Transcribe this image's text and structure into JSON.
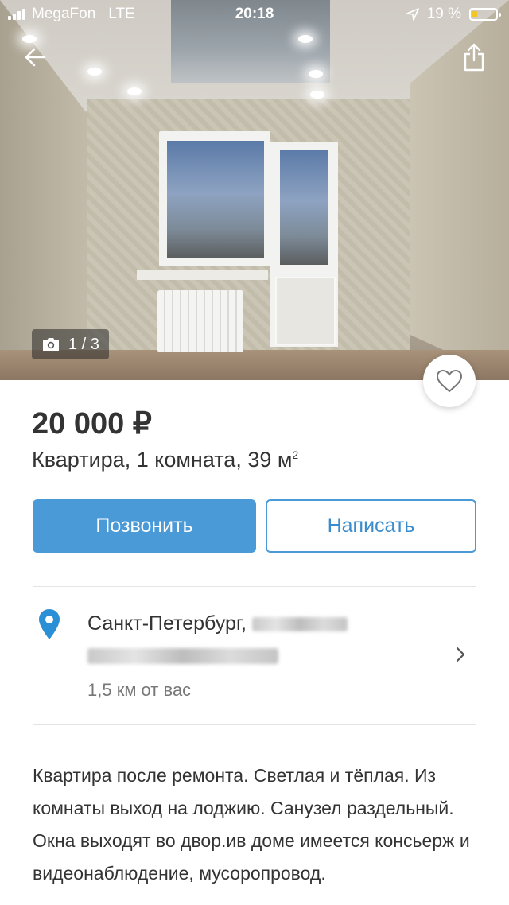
{
  "status_bar": {
    "carrier": "MegaFon",
    "network": "LTE",
    "time": "20:18",
    "battery": "19 %",
    "battery_level": 0.19
  },
  "header": {
    "back_icon": "arrow-left-icon",
    "share_icon": "share-icon"
  },
  "gallery": {
    "camera_icon": "camera-icon",
    "counter": "1 / 3",
    "favorite_icon": "heart-icon"
  },
  "listing": {
    "price": "20 000 ₽",
    "title": "Квартира, 1 комната, 39 м",
    "title_sup": "2"
  },
  "actions": {
    "call_label": "Позвонить",
    "message_label": "Написать"
  },
  "location": {
    "pin_icon": "location-pin-icon",
    "city": "Санкт-Петербург,",
    "distance": "1,5  км от вас",
    "chevron_icon": "chevron-right-icon"
  },
  "description": {
    "text": "Квартира после ремонта. Светлая и тёплая. Из комнаты выход на лоджию. Санузел раздельный. Окна выходят во двор.ив доме имеется консьерж и видеонаблюдение, мусоропровод."
  },
  "colors": {
    "accent": "#4a9ad8",
    "pin": "#2b8fd6"
  }
}
